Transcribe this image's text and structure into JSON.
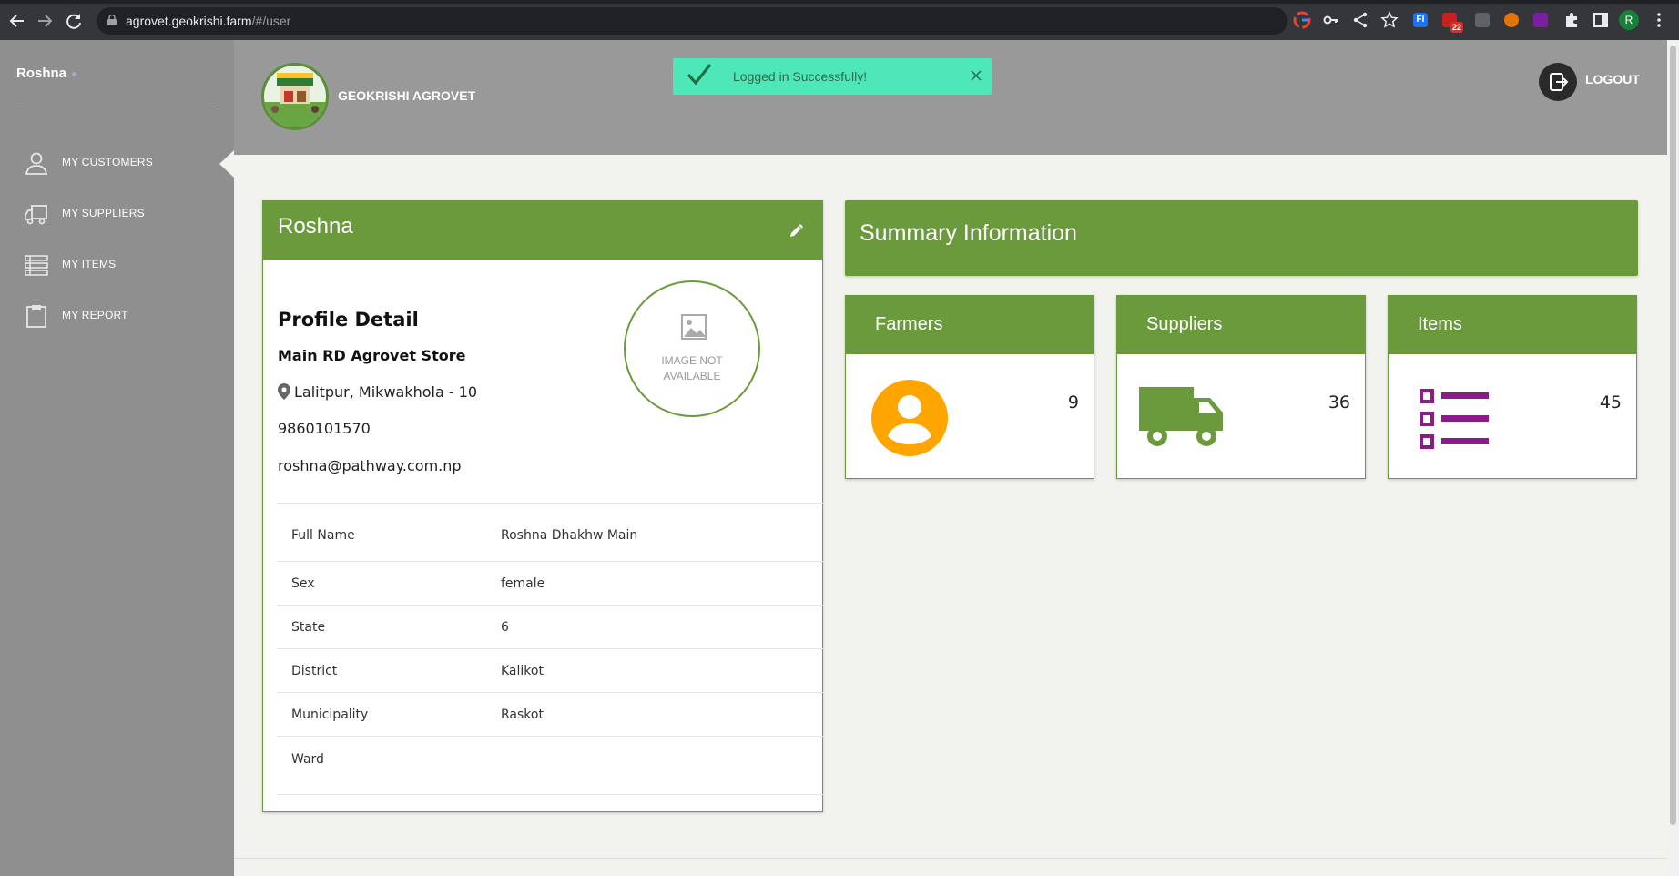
{
  "browser": {
    "url_host": "agrovet.geokrishi.farm",
    "url_path": "/#/user",
    "profile_initial": "R",
    "ext_badge": "22",
    "ext_fi": "FI"
  },
  "sidebar": {
    "user_name": "Roshna",
    "items": [
      {
        "label": "MY CUSTOMERS",
        "icon": "person-icon"
      },
      {
        "label": "MY SUPPLIERS",
        "icon": "truck-icon"
      },
      {
        "label": "MY ITEMS",
        "icon": "list-icon"
      },
      {
        "label": "MY REPORT",
        "icon": "clipboard-icon"
      }
    ]
  },
  "header": {
    "brand_name": "GEOKRISHI AGROVET",
    "toast_message": "Logged in Successfully!",
    "logout_label": "LOGOUT"
  },
  "profile": {
    "name": "Roshna",
    "section_title": "Profile Detail",
    "store_name": "Main RD Agrovet Store",
    "location": "Lalitpur, Mikwakhola - 10",
    "phone": "9860101570",
    "email": "roshna@pathway.com.np",
    "avatar_placeholder_line1": "IMAGE NOT",
    "avatar_placeholder_line2": "AVAILABLE",
    "details": [
      {
        "label": "Full Name",
        "value": "Roshna Dhakhw Main"
      },
      {
        "label": "Sex",
        "value": "female"
      },
      {
        "label": "State",
        "value": "6"
      },
      {
        "label": "District",
        "value": "Kalikot"
      },
      {
        "label": "Municipality",
        "value": "Raskot"
      },
      {
        "label": "Ward",
        "value": ""
      }
    ]
  },
  "summary": {
    "title": "Summary Information",
    "cards": [
      {
        "title": "Farmers",
        "value": "9",
        "icon": "farmer-icon",
        "color": "#ffa500"
      },
      {
        "title": "Suppliers",
        "value": "36",
        "icon": "truck-icon",
        "color": "#6a9a3c"
      },
      {
        "title": "Items",
        "value": "45",
        "icon": "list-icon",
        "color": "#8b1a8b"
      }
    ]
  },
  "colors": {
    "brand_green": "#6a9a3c",
    "header_gray": "#999999",
    "sidebar_gray": "#8f8f8f",
    "toast_green": "#4ee8b8"
  }
}
